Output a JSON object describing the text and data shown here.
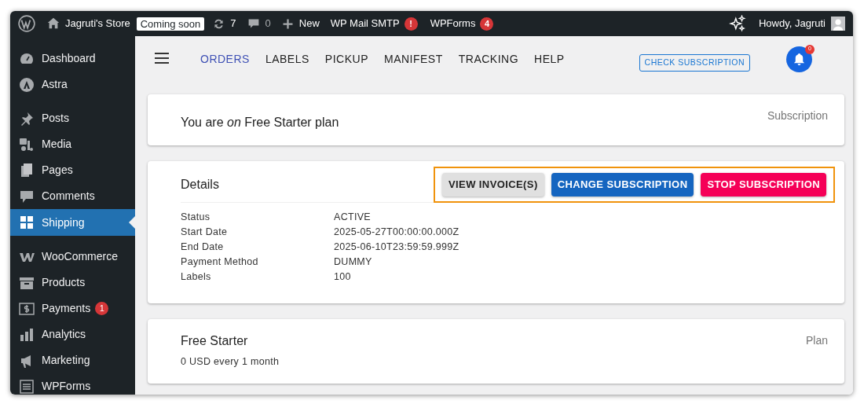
{
  "admin_bar": {
    "site_name": "Jagruti's Store",
    "site_badge": "Coming soon",
    "updates": "7",
    "comments": "0",
    "new": "New",
    "plugins": [
      {
        "label": "WP Mail SMTP",
        "badge": "!"
      },
      {
        "label": "WPForms",
        "badge": "4"
      }
    ],
    "greeting": "Howdy, Jagruti"
  },
  "sidebar": {
    "groups": [
      [
        {
          "label": "Dashboard",
          "selected": false
        },
        {
          "label": "Astra",
          "selected": false
        }
      ],
      [
        {
          "label": "Posts",
          "selected": false
        },
        {
          "label": "Media",
          "selected": false
        },
        {
          "label": "Pages",
          "selected": false
        },
        {
          "label": "Comments",
          "selected": false
        },
        {
          "label": "Shipping",
          "selected": true
        }
      ],
      [
        {
          "label": "WooCommerce",
          "selected": false
        },
        {
          "label": "Products",
          "selected": false
        },
        {
          "label": "Payments",
          "selected": false,
          "badge": "1"
        },
        {
          "label": "Analytics",
          "selected": false
        },
        {
          "label": "Marketing",
          "selected": false
        },
        {
          "label": "WPForms",
          "selected": false
        }
      ]
    ]
  },
  "tabs": [
    {
      "label": "ORDERS",
      "selected": true
    },
    {
      "label": "LABELS",
      "selected": false
    },
    {
      "label": "PICKUP",
      "selected": false
    },
    {
      "label": "MANIFEST",
      "selected": false
    },
    {
      "label": "TRACKING",
      "selected": false
    },
    {
      "label": "HELP",
      "selected": false
    }
  ],
  "check_button": "CHECK SUBSCRIPTION",
  "notifications": "0",
  "subscription_card": {
    "text": "You are *on* Free Starter plan",
    "tag": "Subscription"
  },
  "details_card": {
    "title": "Details",
    "actions": {
      "highlighted": true,
      "buttons": [
        {
          "label": "VIEW INVOICE(S)",
          "kind": "neutral"
        },
        {
          "label": "CHANGE SUBSCRIPTION",
          "kind": "primary"
        },
        {
          "label": "STOP SUBSCRIPTION",
          "kind": "danger"
        }
      ]
    },
    "rows": [
      {
        "label": "Status",
        "value": "ACTIVE"
      },
      {
        "label": "Start Date",
        "value": "2025-05-27T00:00:00.000Z"
      },
      {
        "label": "End Date",
        "value": "2025-06-10T23:59:59.999Z"
      },
      {
        "label": "Payment Method",
        "value": "DUMMY"
      },
      {
        "label": "Labels",
        "value": "100"
      }
    ]
  },
  "plan_card": {
    "title": "Free Starter",
    "price": "0 USD every 1 month",
    "tag": "Plan"
  }
}
